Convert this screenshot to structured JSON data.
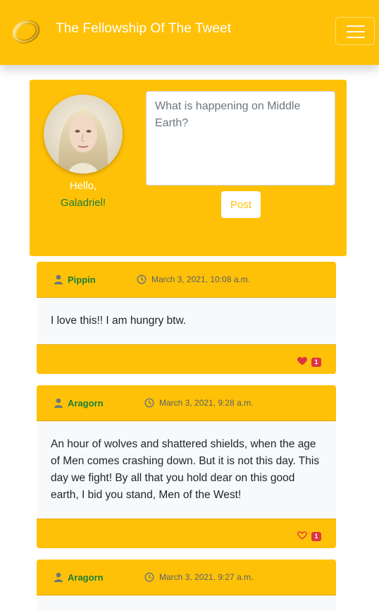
{
  "header": {
    "title": "The Fellowship Of The Tweet",
    "logo_icon": "one-ring-icon",
    "menu_icon": "hamburger-menu-icon"
  },
  "compose": {
    "greeting": "Hello,",
    "user_name": "Galadriel!",
    "placeholder": "What is happening on Middle Earth?",
    "post_label": "Post"
  },
  "tweets": [
    {
      "author": "Pippin",
      "timestamp": "March 3, 2021, 10:08 a.m.",
      "body": "I love this!! I am hungry btw.",
      "likes": "1",
      "liked": true
    },
    {
      "author": "Aragorn",
      "timestamp": "March 3, 2021, 9:28 a.m.",
      "body": "An hour of wolves and shattered shields, when the age of Men comes crashing down. But it is not this day. This day we fight! By all that you hold dear on this good earth, I bid you stand, Men of the West!",
      "likes": "1",
      "liked": false
    },
    {
      "author": "Aragorn",
      "timestamp": "March 3, 2021, 9:27 a.m."
    }
  ],
  "colors": {
    "brand": "#ffc107",
    "author_green": "#1e7e34",
    "like_red": "#dc3545"
  }
}
